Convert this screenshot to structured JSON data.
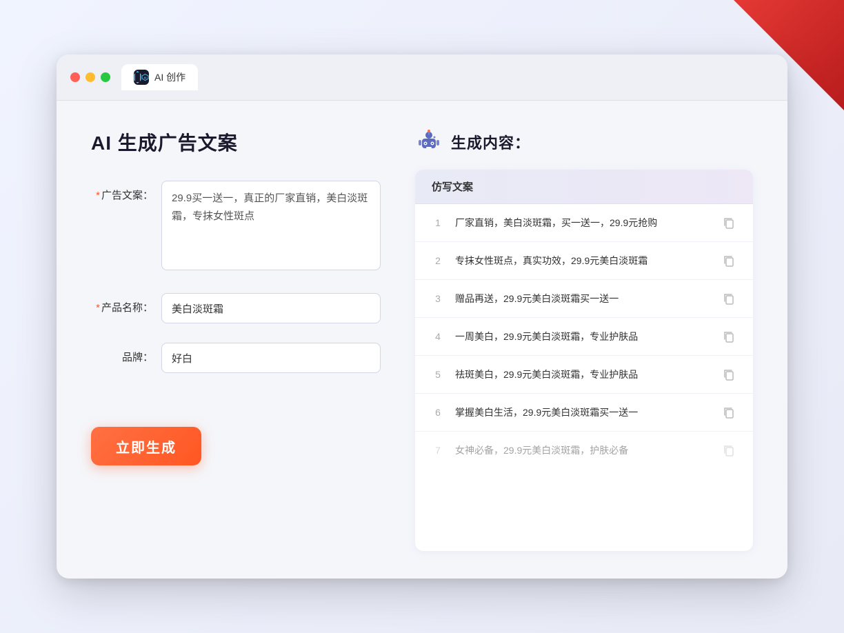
{
  "window": {
    "tab_label": "AI 创作"
  },
  "page": {
    "title": "AI 生成广告文案"
  },
  "form": {
    "ad_copy_label": "广告文案：",
    "ad_copy_required": "*",
    "ad_copy_value": "29.9买一送一，真正的厂家直销，美白淡斑霜，专抹女性斑点",
    "product_name_label": "产品名称：",
    "product_name_required": "*",
    "product_name_value": "美白淡斑霜",
    "brand_label": "品牌：",
    "brand_value": "好白",
    "generate_btn_label": "立即生成"
  },
  "results": {
    "header_title": "生成内容：",
    "column_label": "仿写文案",
    "items": [
      {
        "num": "1",
        "text": "厂家直销，美白淡斑霜，买一送一，29.9元抢购"
      },
      {
        "num": "2",
        "text": "专抹女性斑点，真实功效，29.9元美白淡斑霜"
      },
      {
        "num": "3",
        "text": "赠品再送，29.9元美白淡斑霜买一送一"
      },
      {
        "num": "4",
        "text": "一周美白，29.9元美白淡斑霜，专业护肤品"
      },
      {
        "num": "5",
        "text": "祛斑美白，29.9元美白淡斑霜，专业护肤品"
      },
      {
        "num": "6",
        "text": "掌握美白生活，29.9元美白淡斑霜买一送一"
      },
      {
        "num": "7",
        "text": "女神必备，29.9元美白淡斑霜，护肤必备",
        "dimmed": true
      }
    ]
  }
}
